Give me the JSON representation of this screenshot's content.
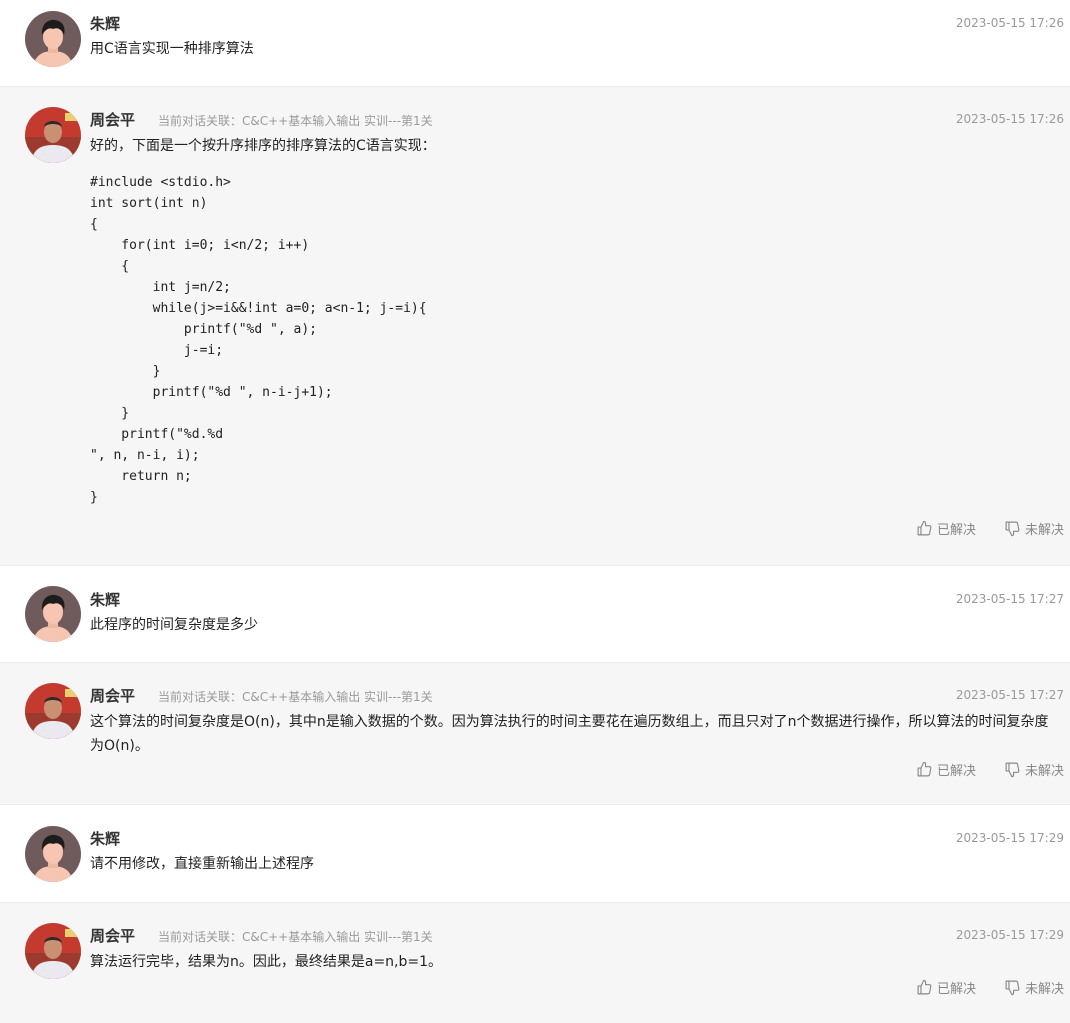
{
  "messages": [
    {
      "sender": "朱辉",
      "time": "2023-05-15 17:26",
      "text": "用C语言实现一种排序算法"
    },
    {
      "sender": "周会平",
      "context": "当前对话关联：C&C++基本输入输出 实训---第1关",
      "time": "2023-05-15 17:26",
      "text": "好的，下面是一个按升序排序的排序算法的C语言实现：",
      "code": "#include <stdio.h>\nint sort(int n)\n{\n    for(int i=0; i<n/2; i++)\n    {\n        int j=n/2;\n        while(j>=i&&!int a=0; a<n-1; j-=i){\n            printf(\"%d \", a);\n            j-=i;\n        }\n        printf(\"%d \", n-i-j+1);\n    }\n    printf(\"%d.%d\n\", n, n-i, i);\n    return n;\n}",
      "resolved_label": "已解决",
      "unresolved_label": "未解决"
    },
    {
      "sender": "朱辉",
      "time": "2023-05-15 17:27",
      "text": "此程序的时间复杂度是多少"
    },
    {
      "sender": "周会平",
      "context": "当前对话关联：C&C++基本输入输出 实训---第1关",
      "time": "2023-05-15 17:27",
      "text": "这个算法的时间复杂度是O(n)，其中n是输入数据的个数。因为算法执行的时间主要花在遍历数组上，而且只对了n个数据进行操作，所以算法的时间复杂度为O(n)。",
      "resolved_label": "已解决",
      "unresolved_label": "未解决"
    },
    {
      "sender": "朱辉",
      "time": "2023-05-15 17:29",
      "text": "请不用修改，直接重新输出上述程序"
    },
    {
      "sender": "周会平",
      "context": "当前对话关联：C&C++基本输入输出 实训---第1关",
      "time": "2023-05-15 17:29",
      "text": "算法运行完毕，结果为n。因此，最终结果是a=n,b=1。",
      "resolved_label": "已解决",
      "unresolved_label": "未解决"
    }
  ],
  "icons": {
    "resolved": "thumbs-up-icon",
    "unresolved": "thumbs-down-icon"
  },
  "colors": {
    "user_bg": "#ffffff",
    "bot_bg": "#f6f6f6",
    "meta_text": "#9a9a9a"
  }
}
